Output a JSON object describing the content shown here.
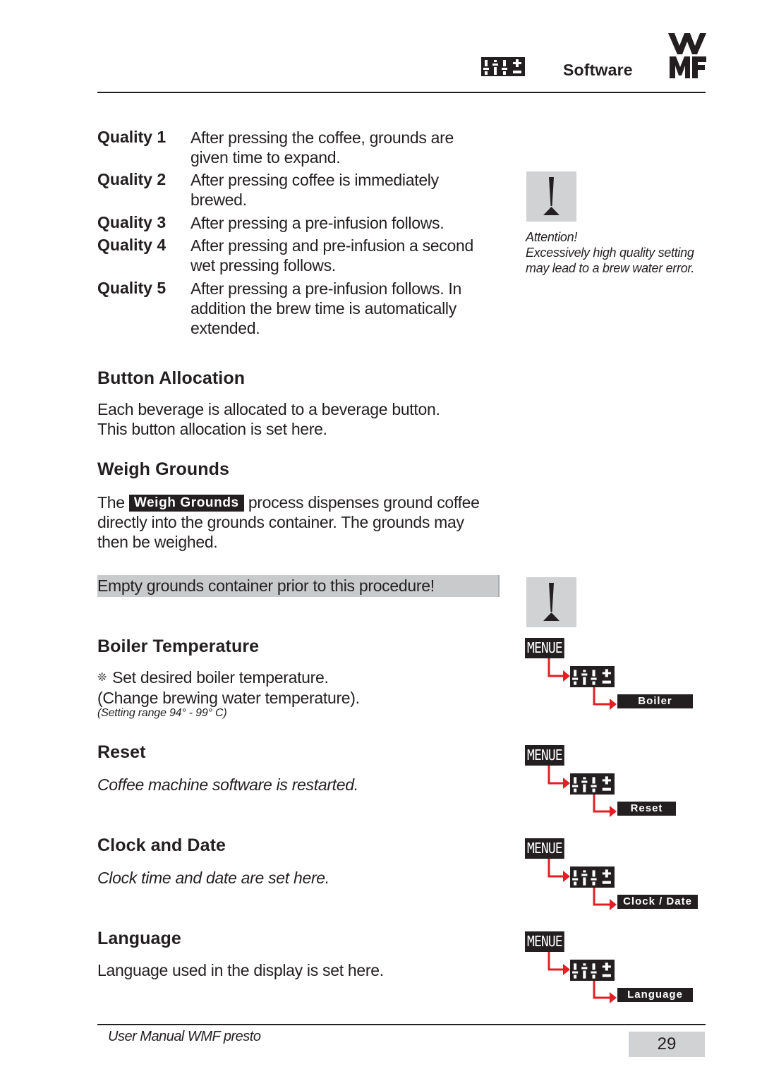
{
  "header": {
    "section_title": "Software",
    "section_icon": "settings-sliders-icon",
    "logo": "wmf-logo"
  },
  "quality": {
    "items": [
      {
        "label": "Quality 1",
        "lines": [
          "After pressing the coffee, grounds are",
          "given time to expand."
        ]
      },
      {
        "label": "Quality 2",
        "lines": [
          "After pressing coffee is immediately",
          "brewed."
        ]
      },
      {
        "label": "Quality 3",
        "lines": [
          "After pressing a pre-infusion follows."
        ]
      },
      {
        "label": "Quality 4",
        "lines": [
          "After pressing and pre-infusion a second",
          "wet pressing follows."
        ]
      },
      {
        "label": "Quality 5",
        "lines": [
          "After pressing a pre-infusion follows. In",
          "addition the brew time is automatically",
          "extended."
        ]
      }
    ]
  },
  "attention": {
    "icon": "attention-exclamation-icon",
    "caption_lines": [
      "Attention!",
      "Excessively high quality setting",
      "may lead to a brew water error."
    ]
  },
  "button_allocation": {
    "heading": "Button Allocation",
    "lines": [
      "Each beverage is allocated to a beverage button.",
      "This button allocation is set here."
    ]
  },
  "weigh_grounds": {
    "heading": "Weigh Grounds",
    "line1_prefix": "The",
    "button_label": "Weigh Grounds",
    "line1_suffix": "process dispenses ground coffee",
    "line2": "directly into the grounds container. The grounds may",
    "line3": "then be weighed.",
    "notice": "Empty grounds container prior to this procedure!"
  },
  "boiler_temperature": {
    "heading": "Boiler Temperature",
    "bullet_symbol": "❊",
    "line1": "Set desired boiler temperature.",
    "line2": "(Change brewing water temperature).",
    "range_note": "(Setting range 94° - 99° C)"
  },
  "reset": {
    "heading": "Reset",
    "text": "Coffee machine software is restarted."
  },
  "clock_date": {
    "heading": "Clock and Date",
    "text": "Clock time and date are set here."
  },
  "language": {
    "heading": "Language",
    "text": "Language used in the display is set here."
  },
  "diagrams": {
    "menu_label": "MENUE",
    "arrow_color": "#e31e24",
    "items": [
      {
        "target": "Boiler temp."
      },
      {
        "target": "Reset"
      },
      {
        "target": "Clock / Date"
      },
      {
        "target": "Language"
      }
    ]
  },
  "footer": {
    "text": "User Manual WMF presto",
    "page_number": "29"
  }
}
